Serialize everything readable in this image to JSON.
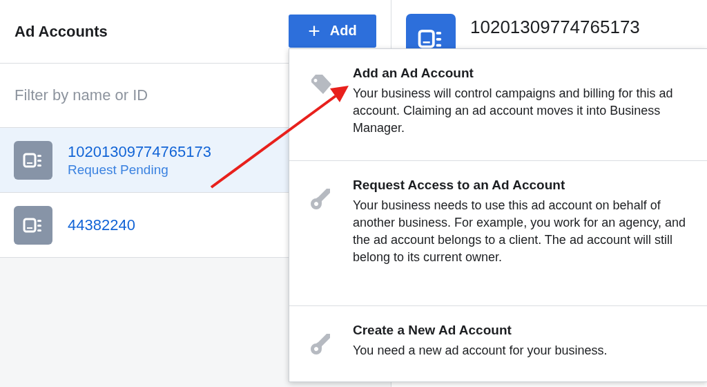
{
  "accounts_panel": {
    "title": "Ad Accounts",
    "add_button": {
      "icon": "+",
      "label": "Add"
    },
    "filter": {
      "placeholder": "Filter by name or ID"
    },
    "accounts": [
      {
        "id": "10201309774765173",
        "status": "Request Pending",
        "selected": true
      },
      {
        "id": "44382240",
        "selected": false
      }
    ]
  },
  "detail": {
    "title": "10201309774765173"
  },
  "add_menu": [
    {
      "kind": "claim",
      "title": "Add an Ad Account",
      "description": "Your business will control campaigns and billing for this ad account. Claiming an ad account moves it into Business Manager."
    },
    {
      "kind": "request",
      "title": "Request Access to an Ad Account",
      "description": "Your business needs to use this ad account on behalf of another business. For example, you work for an agency, and the ad account belongs to a client. The ad account will still belong to its current owner."
    },
    {
      "kind": "create",
      "title": "Create a New Ad Account",
      "description": "You need a new ad account for your business."
    }
  ]
}
